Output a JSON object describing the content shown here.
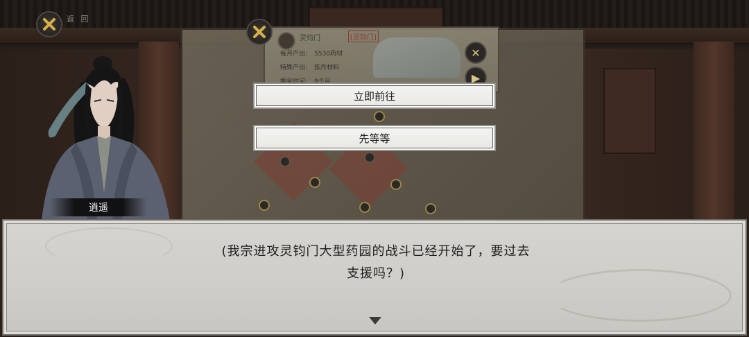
{
  "top_bar": {
    "back_label": "返 回"
  },
  "info_card": {
    "name": "灵钧门",
    "tag": "[灵钧门]",
    "rows": [
      {
        "label": "每月产出:",
        "value": "5530药材"
      },
      {
        "label": "特殊产出:",
        "value": "炼丹材料"
      },
      {
        "label": "剩余时间:",
        "value": "9个月"
      }
    ]
  },
  "choices": [
    {
      "label": "立即前往"
    },
    {
      "label": "先等等"
    }
  ],
  "speaker": {
    "name": "逍遥"
  },
  "dialog": {
    "line1": "(我宗进攻灵钧门大型药园的战斗已经开始了，要过去",
    "line2": "支援吗？)"
  },
  "colors": {
    "gold_icon": "#d6b24a",
    "dialog_bg": "#d3d1cc",
    "choice_bg": "#f0f0ee"
  }
}
